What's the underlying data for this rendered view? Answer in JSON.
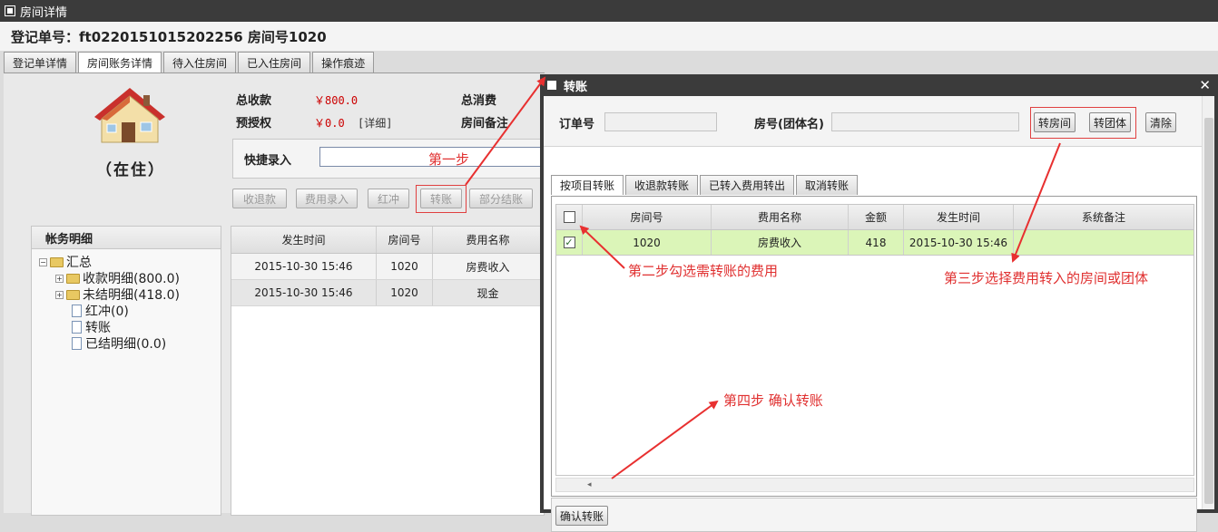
{
  "window": {
    "title": "房间详情"
  },
  "header": {
    "title": "登记单号：ft0220151015202256 房间号1020"
  },
  "tabs": [
    "登记单详情",
    "房间账务详情",
    "待入住房间",
    "已入住房间",
    "操作痕迹"
  ],
  "summary": {
    "status": "（在住）",
    "total_income_label": "总收款",
    "total_income_value": "￥800.0",
    "preauth_label": "预授权",
    "preauth_value": "￥0.0",
    "detail_link": "[详细]",
    "total_consume_label": "总消费",
    "room_note_label": "房间备注"
  },
  "quick_entry": {
    "label": "快捷录入"
  },
  "action_buttons": [
    "收退款",
    "费用录入",
    "红冲",
    "转账",
    "部分结账"
  ],
  "tree": {
    "header": "帐务明细",
    "root": "汇总",
    "items": [
      "收款明细(800.0)",
      "未结明细(418.0)",
      "红冲(0)",
      "转账",
      "已结明细(0.0)"
    ]
  },
  "left_grid": {
    "columns": [
      "发生时间",
      "房间号",
      "费用名称"
    ],
    "rows": [
      [
        "2015-10-30 15:46",
        "1020",
        "房费收入"
      ],
      [
        "2015-10-30 15:46",
        "1020",
        "现金"
      ]
    ]
  },
  "dialog": {
    "title": "转账",
    "order_label": "订单号",
    "room_label": "房号(团体名)",
    "btn_transfer_room": "转房间",
    "btn_transfer_group": "转团体",
    "btn_clear": "清除",
    "tabs": [
      "按项目转账",
      "收退款转账",
      "已转入费用转出",
      "取消转账"
    ],
    "columns": [
      "房间号",
      "费用名称",
      "金额",
      "发生时间",
      "系统备注"
    ],
    "rows": [
      [
        "1020",
        "房费收入",
        "418",
        "2015-10-30 15:46",
        ""
      ]
    ],
    "confirm_button": "确认转账"
  },
  "annotations": {
    "step1": "第一步",
    "step2": "第二步勾选需转账的费用",
    "step3": "第三步选择费用转入的房间或团体",
    "step4": "第四步 确认转账"
  },
  "colors": {
    "accent_red": "#e03030",
    "selected_row": "#dbf5b8",
    "titlebar": "#3b3b3b"
  }
}
